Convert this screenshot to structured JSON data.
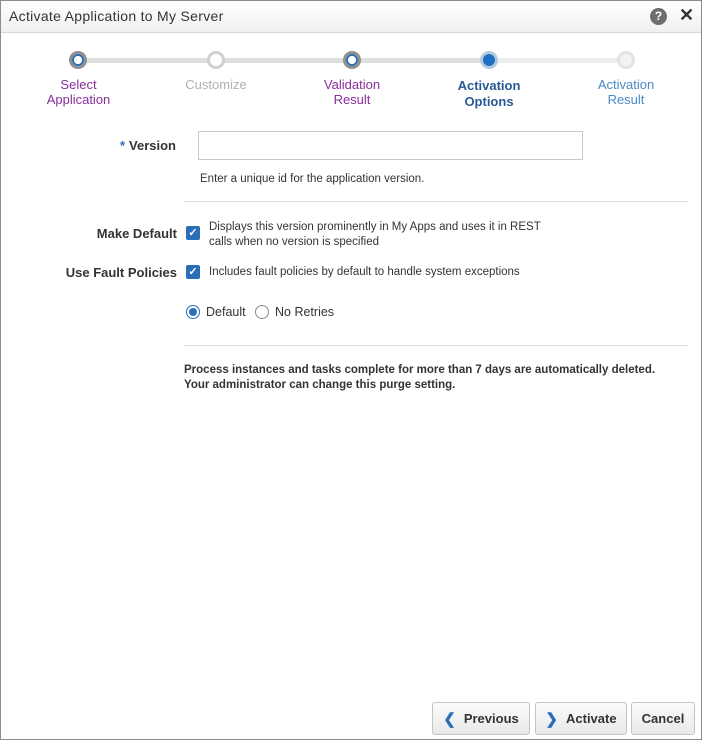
{
  "window": {
    "title": "Activate Application to My Server",
    "help_glyph": "?",
    "close_glyph": "✕"
  },
  "train": {
    "steps": [
      {
        "label_line1": "Select",
        "label_line2": "Application",
        "state": "visited"
      },
      {
        "label_line1": "Customize",
        "label_line2": "",
        "state": "disabled"
      },
      {
        "label_line1": "Validation",
        "label_line2": "Result",
        "state": "visited"
      },
      {
        "label_line1": "Activation",
        "label_line2": "Options",
        "state": "current"
      },
      {
        "label_line1": "Activation",
        "label_line2": "Result",
        "state": "future"
      }
    ]
  },
  "form": {
    "version": {
      "required_mark": "*",
      "label": "Version",
      "value": "",
      "placeholder": "",
      "hint": "Enter a unique id for the application version."
    },
    "make_default": {
      "label": "Make Default",
      "checked": true,
      "check_glyph": "✓",
      "description_line1": "Displays this version prominently in My Apps and uses it in REST",
      "description_line2": "calls when no version is specified"
    },
    "use_fault_policies": {
      "label": "Use Fault Policies",
      "checked": true,
      "check_glyph": "✓",
      "description": "Includes fault policies by default to handle system exceptions"
    },
    "retry_options": [
      {
        "label": "Default",
        "selected": true
      },
      {
        "label": "No Retries",
        "selected": false
      }
    ],
    "notice_line1": "Process instances and tasks complete for more than 7 days are automatically deleted.",
    "notice_line2": "Your administrator can change this purge setting."
  },
  "footer": {
    "previous_label": "Previous",
    "previous_glyph": "❮",
    "activate_label": "Activate",
    "activate_glyph": "❯",
    "cancel_label": "Cancel"
  },
  "colors": {
    "accent": "#2a6eb8",
    "visited_step": "#8a2e9c",
    "disabled_step": "#b0b0b0",
    "future_step": "#4a8ac6"
  }
}
